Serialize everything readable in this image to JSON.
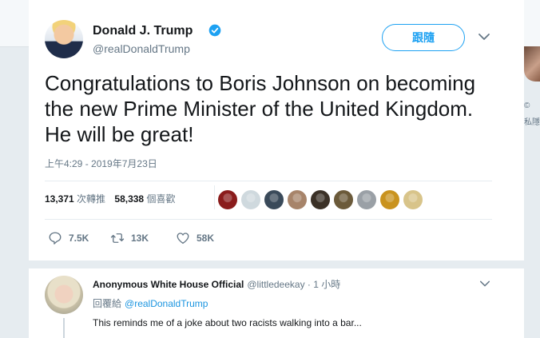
{
  "background": {
    "sidebar_snippets": [
      "©",
      "私隱"
    ]
  },
  "tweet": {
    "author_name": "Donald J. Trump",
    "author_handle": "@realDonaldTrump",
    "verified": true,
    "follow_label": "跟隨",
    "text": "Congratulations to Boris Johnson on becoming the new Prime Minister of the United Kingdom. He will be great!",
    "timestamp": "上午4:29 - 2019年7月23日",
    "retweets": {
      "count": "13,371",
      "label": "次轉推"
    },
    "likes": {
      "count": "58,338",
      "label": "個喜歡"
    },
    "liker_colors": [
      "#8a1c1c",
      "#cfd9de",
      "#3a4a5a",
      "#a7846a",
      "#3b3127",
      "#6b5a3a",
      "#9aa0a6",
      "#c9931f",
      "#d8c48a"
    ],
    "actions": {
      "reply_count": "7.5K",
      "retweet_count": "13K",
      "like_count": "58K"
    },
    "accent_color": "#1da1f2"
  },
  "reply": {
    "author_name": "Anonymous White House Official",
    "author_handle": "@littledeekay",
    "time": "· 1 小時",
    "replying_label": "回覆給",
    "replying_to": "@realDonaldTrump",
    "text": "This reminds me of a joke about two racists walking into a bar..."
  }
}
